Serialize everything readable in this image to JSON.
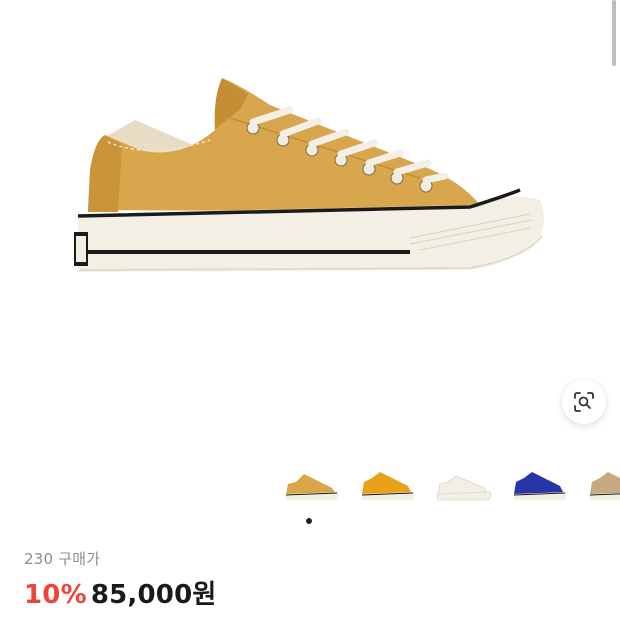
{
  "product": {
    "size": "230",
    "purchase_label": "구매가",
    "discount": "10%",
    "price": "85,000원"
  },
  "gallery": {
    "thumbnails": [
      {
        "name": "sunflower",
        "color": "#d9a64a"
      },
      {
        "name": "orange-yellow",
        "color": "#e9a11a"
      },
      {
        "name": "cream",
        "color": "#f2efe6"
      },
      {
        "name": "blue",
        "color": "#2735a8"
      },
      {
        "name": "tan",
        "color": "#c8a880"
      }
    ],
    "active_index": 0
  },
  "colors": {
    "canvas": "#d8a64c",
    "canvas_shade": "#c48e34",
    "sole": "#f3efe4",
    "stripe": "#1b1b1b",
    "discount": "#f0443a"
  },
  "icons": {
    "lens": "image-search-icon"
  }
}
